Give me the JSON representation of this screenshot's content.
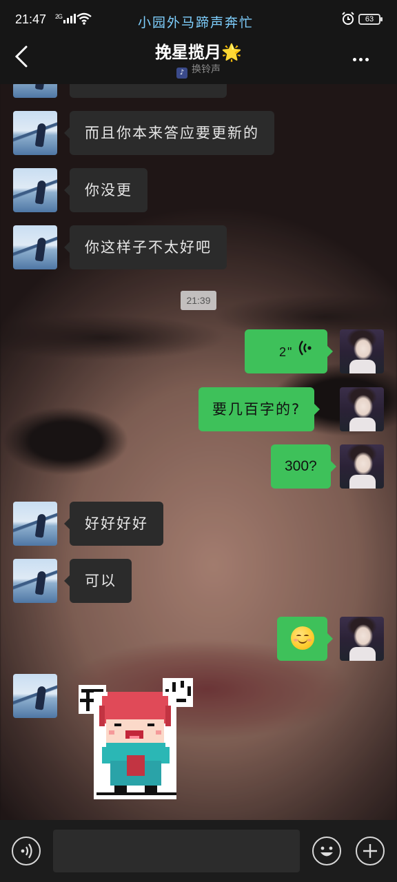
{
  "status_bar": {
    "time": "21:47",
    "network": "2G",
    "marquee": "小园外马蹄声奔忙",
    "battery": "63"
  },
  "header": {
    "title": "挽星揽月",
    "title_emoji": "🌟",
    "subtitle": "换铃声"
  },
  "messages": [
    {
      "side": "in",
      "text": "而且你本来答应要更新的"
    },
    {
      "side": "in",
      "text": "你没更"
    },
    {
      "side": "in",
      "text": "你这样子不太好吧"
    },
    {
      "type": "time",
      "text": "21:39"
    },
    {
      "side": "out",
      "type": "voice",
      "text": "2\""
    },
    {
      "side": "out",
      "text": "要几百字的?"
    },
    {
      "side": "out",
      "text": "300?"
    },
    {
      "side": "in",
      "text": "好好好好"
    },
    {
      "side": "in",
      "text": "可以"
    },
    {
      "side": "out",
      "type": "emoji",
      "emoji_name": "smiling-face-icon"
    },
    {
      "side": "in",
      "type": "sticker",
      "text": "开心"
    }
  ],
  "colors": {
    "outgoing_bubble": "#3ec15a",
    "incoming_bubble": "#2b2b2b",
    "marquee_text": "#7fd0ff"
  }
}
